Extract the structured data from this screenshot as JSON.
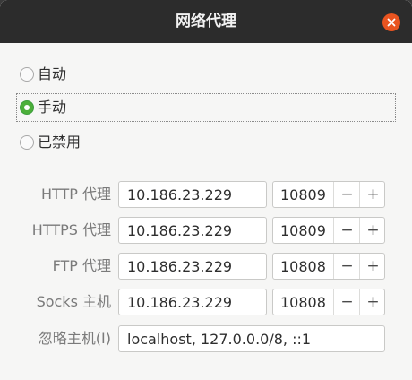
{
  "window": {
    "title": "网络代理"
  },
  "modes": [
    {
      "label": "自动",
      "selected": false
    },
    {
      "label": "手动",
      "selected": true
    },
    {
      "label": "已禁用",
      "selected": false
    }
  ],
  "proxies": [
    {
      "label": "HTTP 代理",
      "host": "10.186.23.229",
      "port": "10809"
    },
    {
      "label": "HTTPS 代理",
      "host": "10.186.23.229",
      "port": "10809"
    },
    {
      "label": "FTP 代理",
      "host": "10.186.23.229",
      "port": "10808"
    },
    {
      "label": "Socks 主机",
      "host": "10.186.23.229",
      "port": "10808"
    }
  ],
  "ignore": {
    "label": "忽略主机(I)",
    "value": "localhost, 127.0.0.0/8, ::1"
  },
  "spin": {
    "minus": "−",
    "plus": "+"
  },
  "colors": {
    "titlebar": "#2c2c2c",
    "close": "#e95420",
    "radio_checked": "#4caf3a"
  },
  "icons": {
    "close": "close-icon"
  }
}
